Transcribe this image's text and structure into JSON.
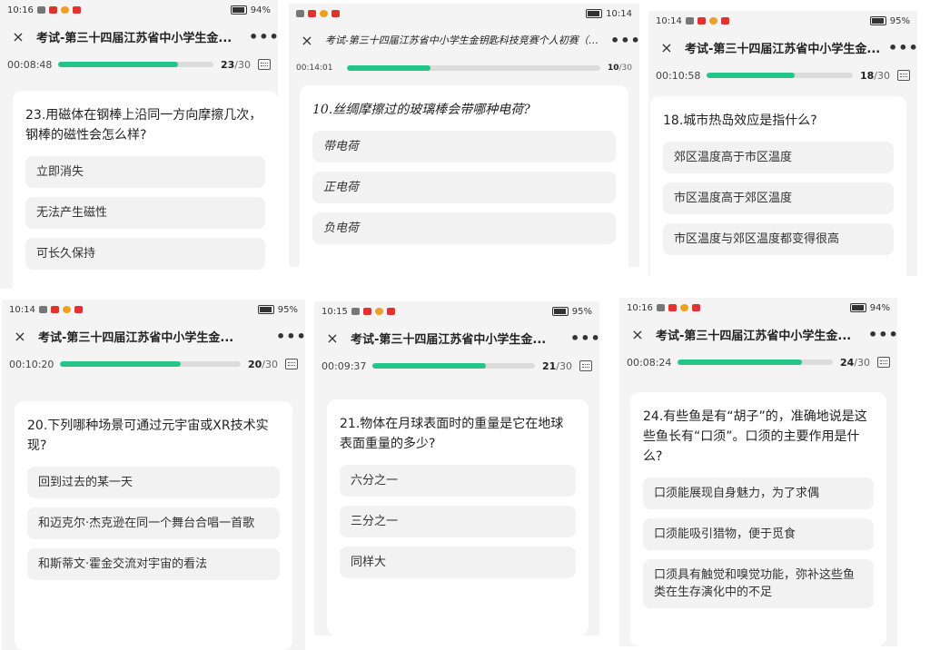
{
  "panels": [
    {
      "status": {
        "time": "10:16",
        "battery": "94%"
      },
      "title": "考试-第三十四届江苏省中小学生金...",
      "timer": "00:08:48",
      "current": "23",
      "total": "/30",
      "progress": 0.77,
      "question": "23.用磁体在钢棒上沿同一方向摩擦几次，钢棒的磁性会怎么样?",
      "options": [
        "立即消失",
        "无法产生磁性",
        "可长久保持"
      ]
    },
    {
      "status": {
        "time": "10:14",
        "battery": ""
      },
      "title": "考试-第三十四届江苏省中小学生金钥匙科技竞赛个人初赛（网络赛）",
      "timer": "00:14:01",
      "current": "10",
      "total": "/30",
      "progress": 0.33,
      "question": "10.丝绸摩擦过的玻璃棒会带哪种电荷?",
      "options": [
        "带电荷",
        "正电荷",
        "负电荷"
      ]
    },
    {
      "status": {
        "time": "10:14",
        "battery": "95%"
      },
      "title": "考试-第三十四届江苏省中小学生金...",
      "timer": "00:10:58",
      "current": "18",
      "total": "/30",
      "progress": 0.6,
      "question": "18.城市热岛效应是指什么?",
      "options": [
        "郊区温度高于市区温度",
        "市区温度高于郊区温度",
        "市区温度与郊区温度都变得很高"
      ]
    },
    {
      "status": {
        "time": "10:14",
        "battery": "95%"
      },
      "title": "考试-第三十四届江苏省中小学生金...",
      "timer": "00:10:20",
      "current": "20",
      "total": "/30",
      "progress": 0.67,
      "question": "20.下列哪种场景可通过元宇宙或XR技术实现?",
      "options": [
        "回到过去的某一天",
        "和迈克尔·杰克逊在同一个舞台合唱一首歌",
        "和斯蒂文·霍金交流对宇宙的看法"
      ]
    },
    {
      "status": {
        "time": "10:15",
        "battery": "95%"
      },
      "title": "考试-第三十四届江苏省中小学生金...",
      "timer": "00:09:37",
      "current": "21",
      "total": "/30",
      "progress": 0.7,
      "question": "21.物体在月球表面时的重量是它在地球表面重量的多少?",
      "options": [
        "六分之一",
        "三分之一",
        "同样大"
      ]
    },
    {
      "status": {
        "time": "10:16",
        "battery": "94%"
      },
      "title": "考试-第三十四届江苏省中小学生金...",
      "timer": "00:08:24",
      "current": "24",
      "total": "/30",
      "progress": 0.8,
      "question": "24.有些鱼是有“胡子”的，准确地说是这些鱼长有“口须”。口须的主要作用是什么?",
      "options": [
        "口须能展现自身魅力，为了求偶",
        "口须能吸引猎物，便于觅食",
        "口须具有触觉和嗅觉功能，弥补这些鱼类在生存演化中的不足"
      ]
    }
  ],
  "icons": {
    "close": "×",
    "more": "•••"
  },
  "colors": {
    "accent": "#27c48a",
    "status_red": "#e0332e"
  }
}
